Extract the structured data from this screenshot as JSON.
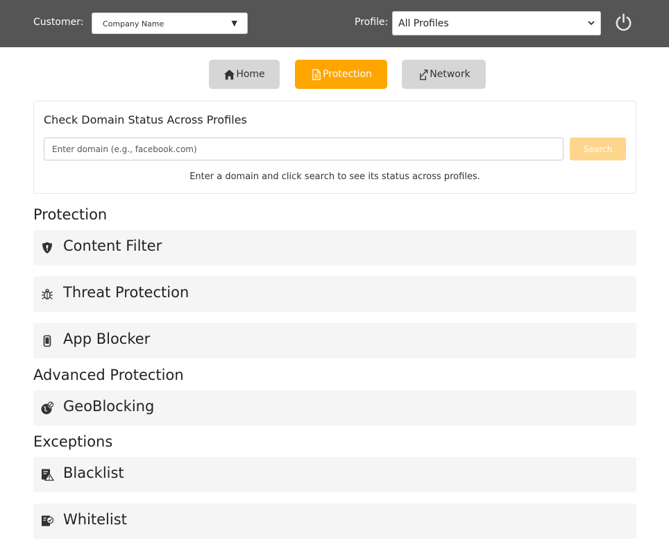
{
  "header": {
    "customer_label": "Customer:",
    "customer_value": "Company Name",
    "customer_arrow": "▼",
    "profile_label": "Profile:",
    "profile_value": "All Profiles",
    "power_icon": "power-icon"
  },
  "tabs": [
    {
      "label": "Home",
      "icon": "home-icon",
      "active": false
    },
    {
      "label": "Protection",
      "icon": "document-icon",
      "active": true
    },
    {
      "label": "Network",
      "icon": "link-icon",
      "active": false
    }
  ],
  "domain_check": {
    "title": "Check Domain Status Across Profiles",
    "placeholder": "Enter domain (e.g., facebook.com)",
    "value": "",
    "search_label": "Search",
    "hint": "Enter a domain and click search to see its status across profiles."
  },
  "sections": [
    {
      "title": "Protection",
      "items": [
        {
          "label": "Content Filter",
          "icon": "shield-icon"
        },
        {
          "label": "Threat Protection",
          "icon": "bug-icon"
        },
        {
          "label": "App Blocker",
          "icon": "mobile-icon"
        }
      ]
    },
    {
      "title": "Advanced Protection",
      "items": [
        {
          "label": "GeoBlocking",
          "icon": "globe-icon"
        }
      ]
    },
    {
      "title": "Exceptions",
      "items": [
        {
          "label": "Blacklist",
          "icon": "blacklist-icon"
        },
        {
          "label": "Whitelist",
          "icon": "whitelist-icon"
        }
      ]
    }
  ],
  "colors": {
    "topbar": "#555555",
    "accent": "#ffa500",
    "tab_inactive": "#d6d6d6",
    "search_button": "#fdd58c",
    "row_background": "#f5f5f5"
  }
}
